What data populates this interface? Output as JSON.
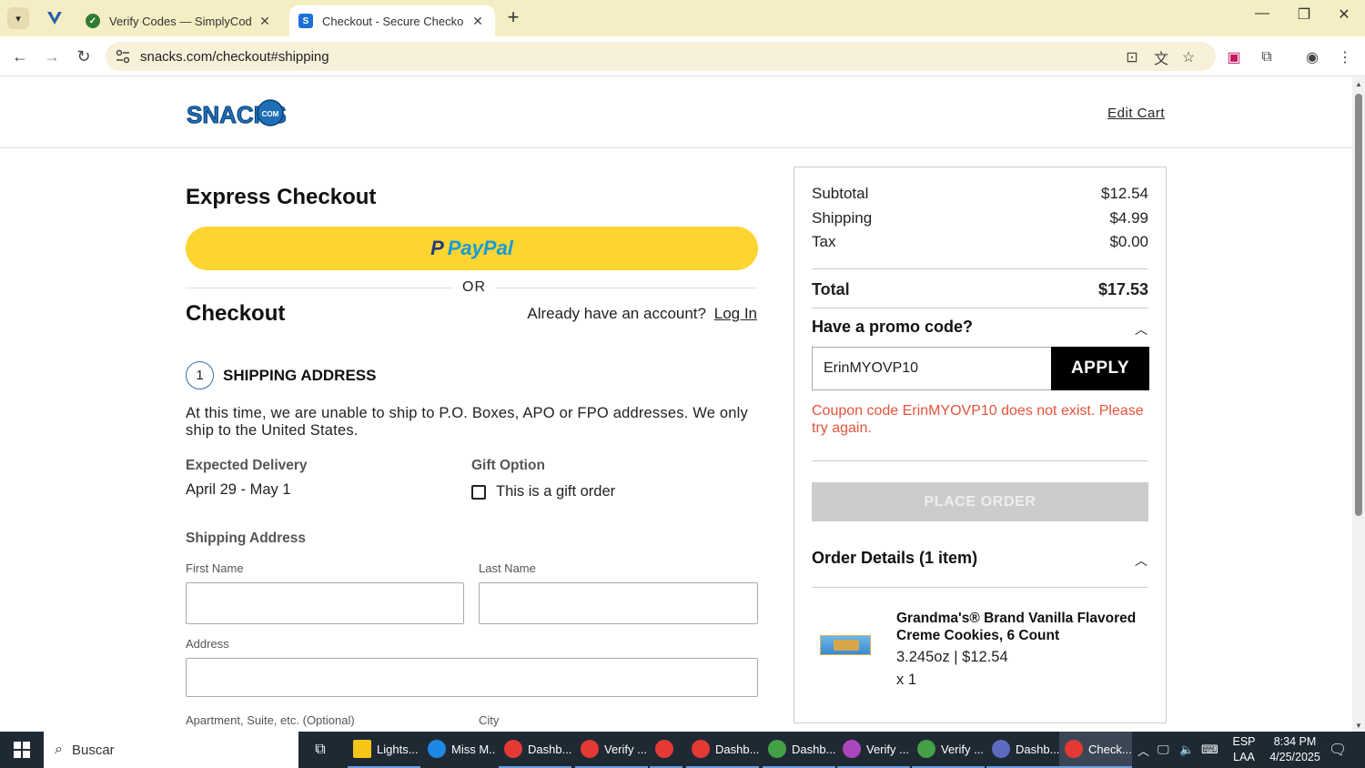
{
  "browser": {
    "tabs": [
      {
        "title": "Verify Codes — SimplyCodes",
        "active": false
      },
      {
        "title": "Checkout - Secure Checkout - S",
        "active": true
      }
    ],
    "url": "snacks.com/checkout#shipping"
  },
  "header": {
    "logo_text": "SNACKS",
    "logo_suffix": "COM",
    "edit_cart": "Edit Cart"
  },
  "express": {
    "title": "Express Checkout",
    "paypal_p": "P",
    "paypal_label": "PayPal",
    "or": "OR"
  },
  "checkout": {
    "title": "Checkout",
    "have_account": "Already have an account?",
    "login": "Log In",
    "step_number": "1",
    "step_title": "SHIPPING ADDRESS",
    "notice": "At this time, we are unable to ship to P.O. Boxes, APO or FPO addresses. We only ship to the United States.",
    "expected_delivery_label": "Expected Delivery",
    "expected_delivery_value": "April 29 - May 1",
    "gift_option_label": "Gift Option",
    "gift_checkbox_label": "This is a gift order",
    "shipping_address_label": "Shipping Address",
    "fields": {
      "first_name": "First Name",
      "last_name": "Last Name",
      "address": "Address",
      "apartment": "Apartment, Suite, etc. (Optional)",
      "city": "City"
    }
  },
  "summary": {
    "subtotal_label": "Subtotal",
    "subtotal": "$12.54",
    "shipping_label": "Shipping",
    "shipping": "$4.99",
    "tax_label": "Tax",
    "tax": "$0.00",
    "total_label": "Total",
    "total": "$17.53",
    "promo_title": "Have a promo code?",
    "promo_value": "ErinMYOVP10",
    "apply": "APPLY",
    "promo_error": "Coupon code ErinMYOVP10 does not exist. Please try again.",
    "place_order": "PLACE ORDER",
    "order_details": "Order Details (1 item)",
    "item_name": "Grandma's® Brand Vanilla Flavored Creme Cookies, 6 Count",
    "item_meta": "3.245oz | $12.54",
    "item_qty": "x 1"
  },
  "taskbar": {
    "search": "Buscar",
    "apps": [
      {
        "label": "Lights...",
        "color": "#f5c518"
      },
      {
        "label": "Miss M...",
        "color": "#1e88e5"
      },
      {
        "label": "Dashb...",
        "color": "#e53935"
      },
      {
        "label": "Verify ...",
        "color": "#e53935"
      },
      {
        "label": "",
        "color": "#e53935"
      },
      {
        "label": "Dashb...",
        "color": "#e53935"
      },
      {
        "label": "Dashb...",
        "color": "#43a047"
      },
      {
        "label": "Verify ...",
        "color": "#ab47bc"
      },
      {
        "label": "Verify ...",
        "color": "#43a047"
      },
      {
        "label": "Dashb...",
        "color": "#5c6bc0"
      },
      {
        "label": "Check...",
        "color": "#e53935"
      }
    ],
    "lang_top": "ESP",
    "lang_bottom": "LAA",
    "time": "8:34 PM",
    "date": "4/25/2025"
  }
}
